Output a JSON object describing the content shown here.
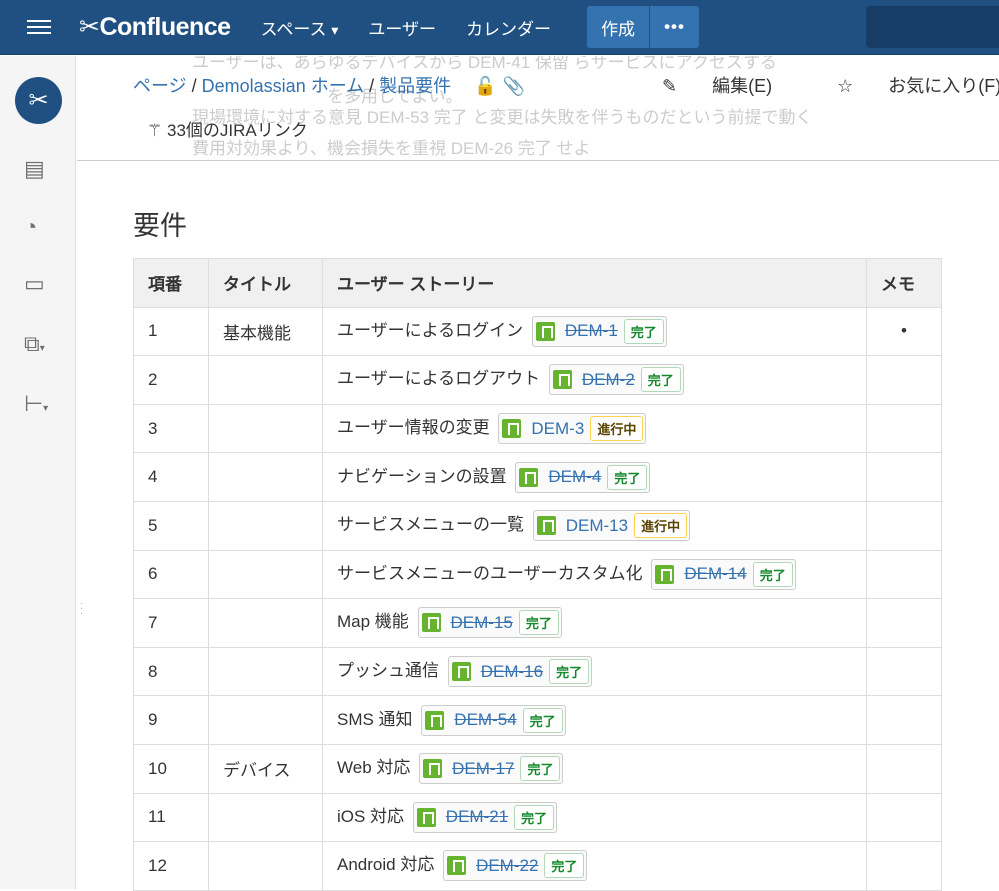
{
  "topbar": {
    "app": "Confluence",
    "nav": [
      "スペース",
      "ユーザー",
      "カレンダー"
    ],
    "create": "作成",
    "more": "•••"
  },
  "ghost": [
    "ユーザーは、あらゆるデバイスから DEM-41 保留 らサービスにアクセスする",
    "を多用してよい。",
    "現場環境に対する意見 DEM-53 完了 と変更は失敗を伴うものだという前提で動く",
    "費用対効果より、機会損失を重視 DEM-26 完了 せよ"
  ],
  "breadcrumb": [
    "ページ",
    "Demolassian ホーム",
    "製品要件"
  ],
  "actions": {
    "edit": "編集(E)",
    "favorite": "お気に入り(F)"
  },
  "jira_links": "33個のJIRAリンク",
  "section_title": "要件",
  "table": {
    "headers": [
      "項番",
      "タイトル",
      "ユーザー ストーリー",
      "メモ"
    ],
    "rows": [
      {
        "no": "1",
        "title": "基本機能",
        "story": "ユーザーによるログイン",
        "key": "DEM-1",
        "status": "完了",
        "done": true,
        "memo": "•"
      },
      {
        "no": "2",
        "title": "",
        "story": "ユーザーによるログアウト",
        "key": "DEM-2",
        "status": "完了",
        "done": true,
        "memo": ""
      },
      {
        "no": "3",
        "title": "",
        "story": "ユーザー情報の変更",
        "key": "DEM-3",
        "status": "進行中",
        "done": false,
        "memo": ""
      },
      {
        "no": "4",
        "title": "",
        "story": "ナビゲーションの設置",
        "key": "DEM-4",
        "status": "完了",
        "done": true,
        "memo": ""
      },
      {
        "no": "5",
        "title": "",
        "story": "サービスメニューの一覧",
        "key": "DEM-13",
        "status": "進行中",
        "done": false,
        "memo": ""
      },
      {
        "no": "6",
        "title": "",
        "story": "サービスメニューのユーザーカスタム化",
        "key": "DEM-14",
        "status": "完了",
        "done": true,
        "memo": ""
      },
      {
        "no": "7",
        "title": "",
        "story": "Map 機能",
        "key": "DEM-15",
        "status": "完了",
        "done": true,
        "memo": ""
      },
      {
        "no": "8",
        "title": "",
        "story": "プッシュ通信",
        "key": "DEM-16",
        "status": "完了",
        "done": true,
        "memo": ""
      },
      {
        "no": "9",
        "title": "",
        "story": "SMS 通知",
        "key": "DEM-54",
        "status": "完了",
        "done": true,
        "memo": ""
      },
      {
        "no": "10",
        "title": "デバイス",
        "story": "Web 対応",
        "key": "DEM-17",
        "status": "完了",
        "done": true,
        "memo": ""
      },
      {
        "no": "11",
        "title": "",
        "story": "iOS 対応",
        "key": "DEM-21",
        "status": "完了",
        "done": true,
        "memo": ""
      },
      {
        "no": "12",
        "title": "",
        "story": "Android 対応",
        "key": "DEM-22",
        "status": "完了",
        "done": true,
        "memo": ""
      }
    ]
  }
}
